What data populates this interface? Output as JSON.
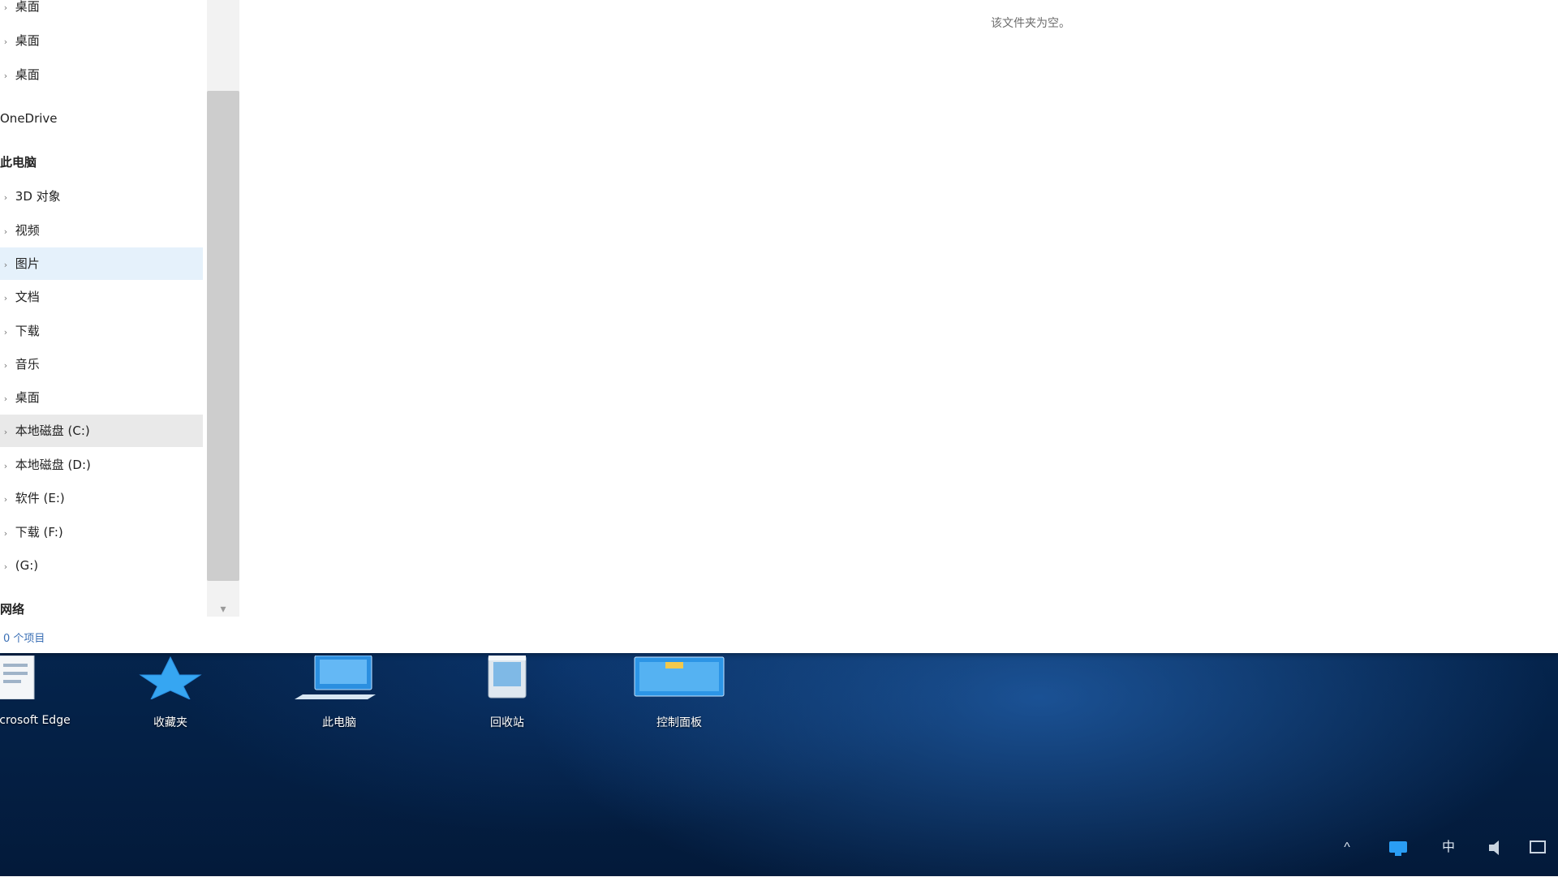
{
  "explorer": {
    "nav": {
      "items": [
        {
          "label": "桌面",
          "indent": 1,
          "state": "normal"
        },
        {
          "label": "OneDrive",
          "indent": 0,
          "state": "normal"
        },
        {
          "label": "此电脑",
          "indent": 0,
          "state": "normal"
        },
        {
          "label": "3D 对象",
          "indent": 1,
          "state": "normal"
        },
        {
          "label": "视频",
          "indent": 1,
          "state": "normal"
        },
        {
          "label": "图片",
          "indent": 1,
          "state": "selected"
        },
        {
          "label": "文档",
          "indent": 1,
          "state": "normal"
        },
        {
          "label": "下载",
          "indent": 1,
          "state": "normal"
        },
        {
          "label": "音乐",
          "indent": 1,
          "state": "normal"
        },
        {
          "label": "桌面",
          "indent": 1,
          "state": "normal"
        },
        {
          "label": "本地磁盘 (C:)",
          "indent": 1,
          "state": "hover"
        },
        {
          "label": "本地磁盘 (D:)",
          "indent": 1,
          "state": "normal"
        },
        {
          "label": "软件 (E:)",
          "indent": 1,
          "state": "normal"
        },
        {
          "label": "下载 (F:)",
          "indent": 1,
          "state": "normal"
        },
        {
          "label": "(G:)",
          "indent": 1,
          "state": "normal"
        },
        {
          "label": "网络",
          "indent": 0,
          "state": "normal"
        }
      ]
    },
    "content": {
      "empty_message": "该文件夹为空。"
    },
    "status": {
      "item_count": "0 个项目"
    }
  },
  "desktop": {
    "icons": [
      {
        "label": "Microsoft Edge",
        "icon": "document-icon"
      },
      {
        "label": "收藏夹",
        "icon": "star-icon"
      },
      {
        "label": "此电脑",
        "icon": "computer-icon"
      },
      {
        "label": "回收站",
        "icon": "recycle-bin-icon"
      },
      {
        "label": "控制面板",
        "icon": "control-panel-icon"
      }
    ]
  },
  "tray": {
    "items": [
      {
        "icon": "chevron-up-icon",
        "label": "^"
      },
      {
        "icon": "network-icon",
        "label": ""
      },
      {
        "icon": "input-method-icon",
        "label": "中"
      },
      {
        "icon": "volume-icon",
        "label": ""
      },
      {
        "icon": "notification-icon",
        "label": ""
      }
    ]
  },
  "colors": {
    "selected_bg": "#e5f1fb",
    "hover_bg": "#e9e9e9",
    "desktop_blue": "#08356a"
  }
}
